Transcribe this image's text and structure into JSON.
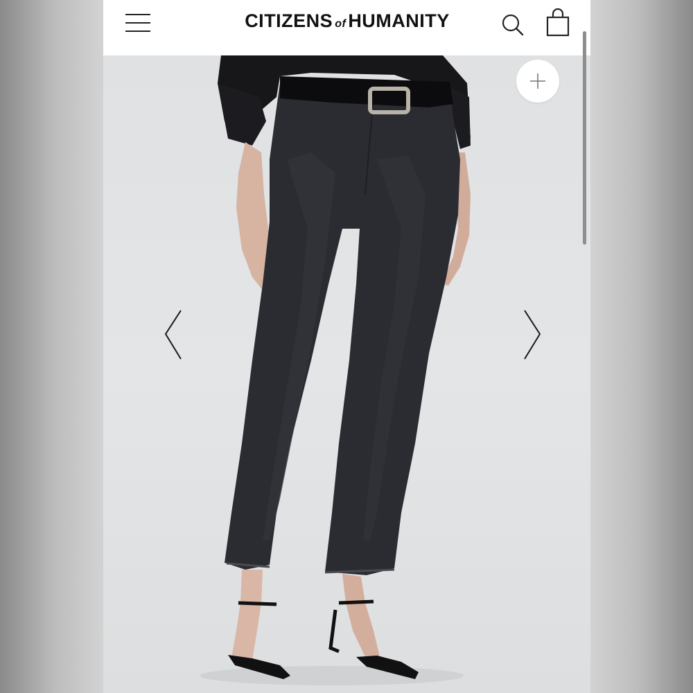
{
  "header": {
    "logo_part1": "CITIZENS",
    "logo_part2": "of",
    "logo_part3": "HUMANITY",
    "menu_icon": "hamburger-menu-icon",
    "search_icon": "search-icon",
    "bag_icon": "shopping-bag-icon"
  },
  "gallery": {
    "zoom_icon": "plus-icon",
    "prev_icon": "chevron-left-icon",
    "next_icon": "chevron-right-icon",
    "image_subject": "model-wearing-black-cropped-jeans"
  },
  "colors": {
    "header_bg": "#ffffff",
    "text": "#111111",
    "denim": "#2b2c31",
    "background": "#e2e4e6"
  }
}
